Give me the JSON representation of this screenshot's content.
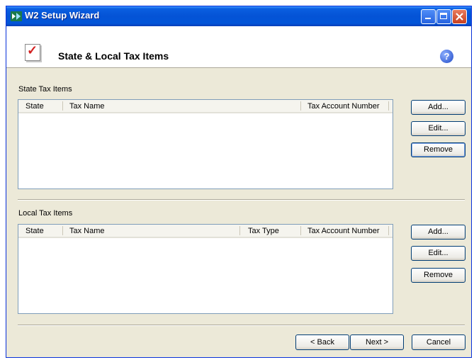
{
  "window": {
    "title": "W2 Setup Wizard"
  },
  "header": {
    "title": "State & Local Tax Items",
    "help_glyph": "?"
  },
  "state_section": {
    "label": "State Tax Items",
    "columns": [
      "State",
      "Tax Name",
      "Tax Account Number"
    ],
    "rows": [],
    "buttons": {
      "add": "Add...",
      "edit": "Edit...",
      "remove": "Remove"
    }
  },
  "local_section": {
    "label": "Local Tax Items",
    "columns": [
      "State",
      "Tax Name",
      "Tax Type",
      "Tax Account Number"
    ],
    "rows": [],
    "buttons": {
      "add": "Add...",
      "edit": "Edit...",
      "remove": "Remove"
    }
  },
  "footer": {
    "back": "< Back",
    "next": "Next >",
    "cancel": "Cancel"
  },
  "icons": {
    "app": "w2-app-icon",
    "header": "checklist-icon",
    "help": "help-icon"
  },
  "colors": {
    "titlebar": "#0453d6",
    "close_button": "#c8401f",
    "checkmark": "#d32020",
    "face": "#ece9d8"
  }
}
